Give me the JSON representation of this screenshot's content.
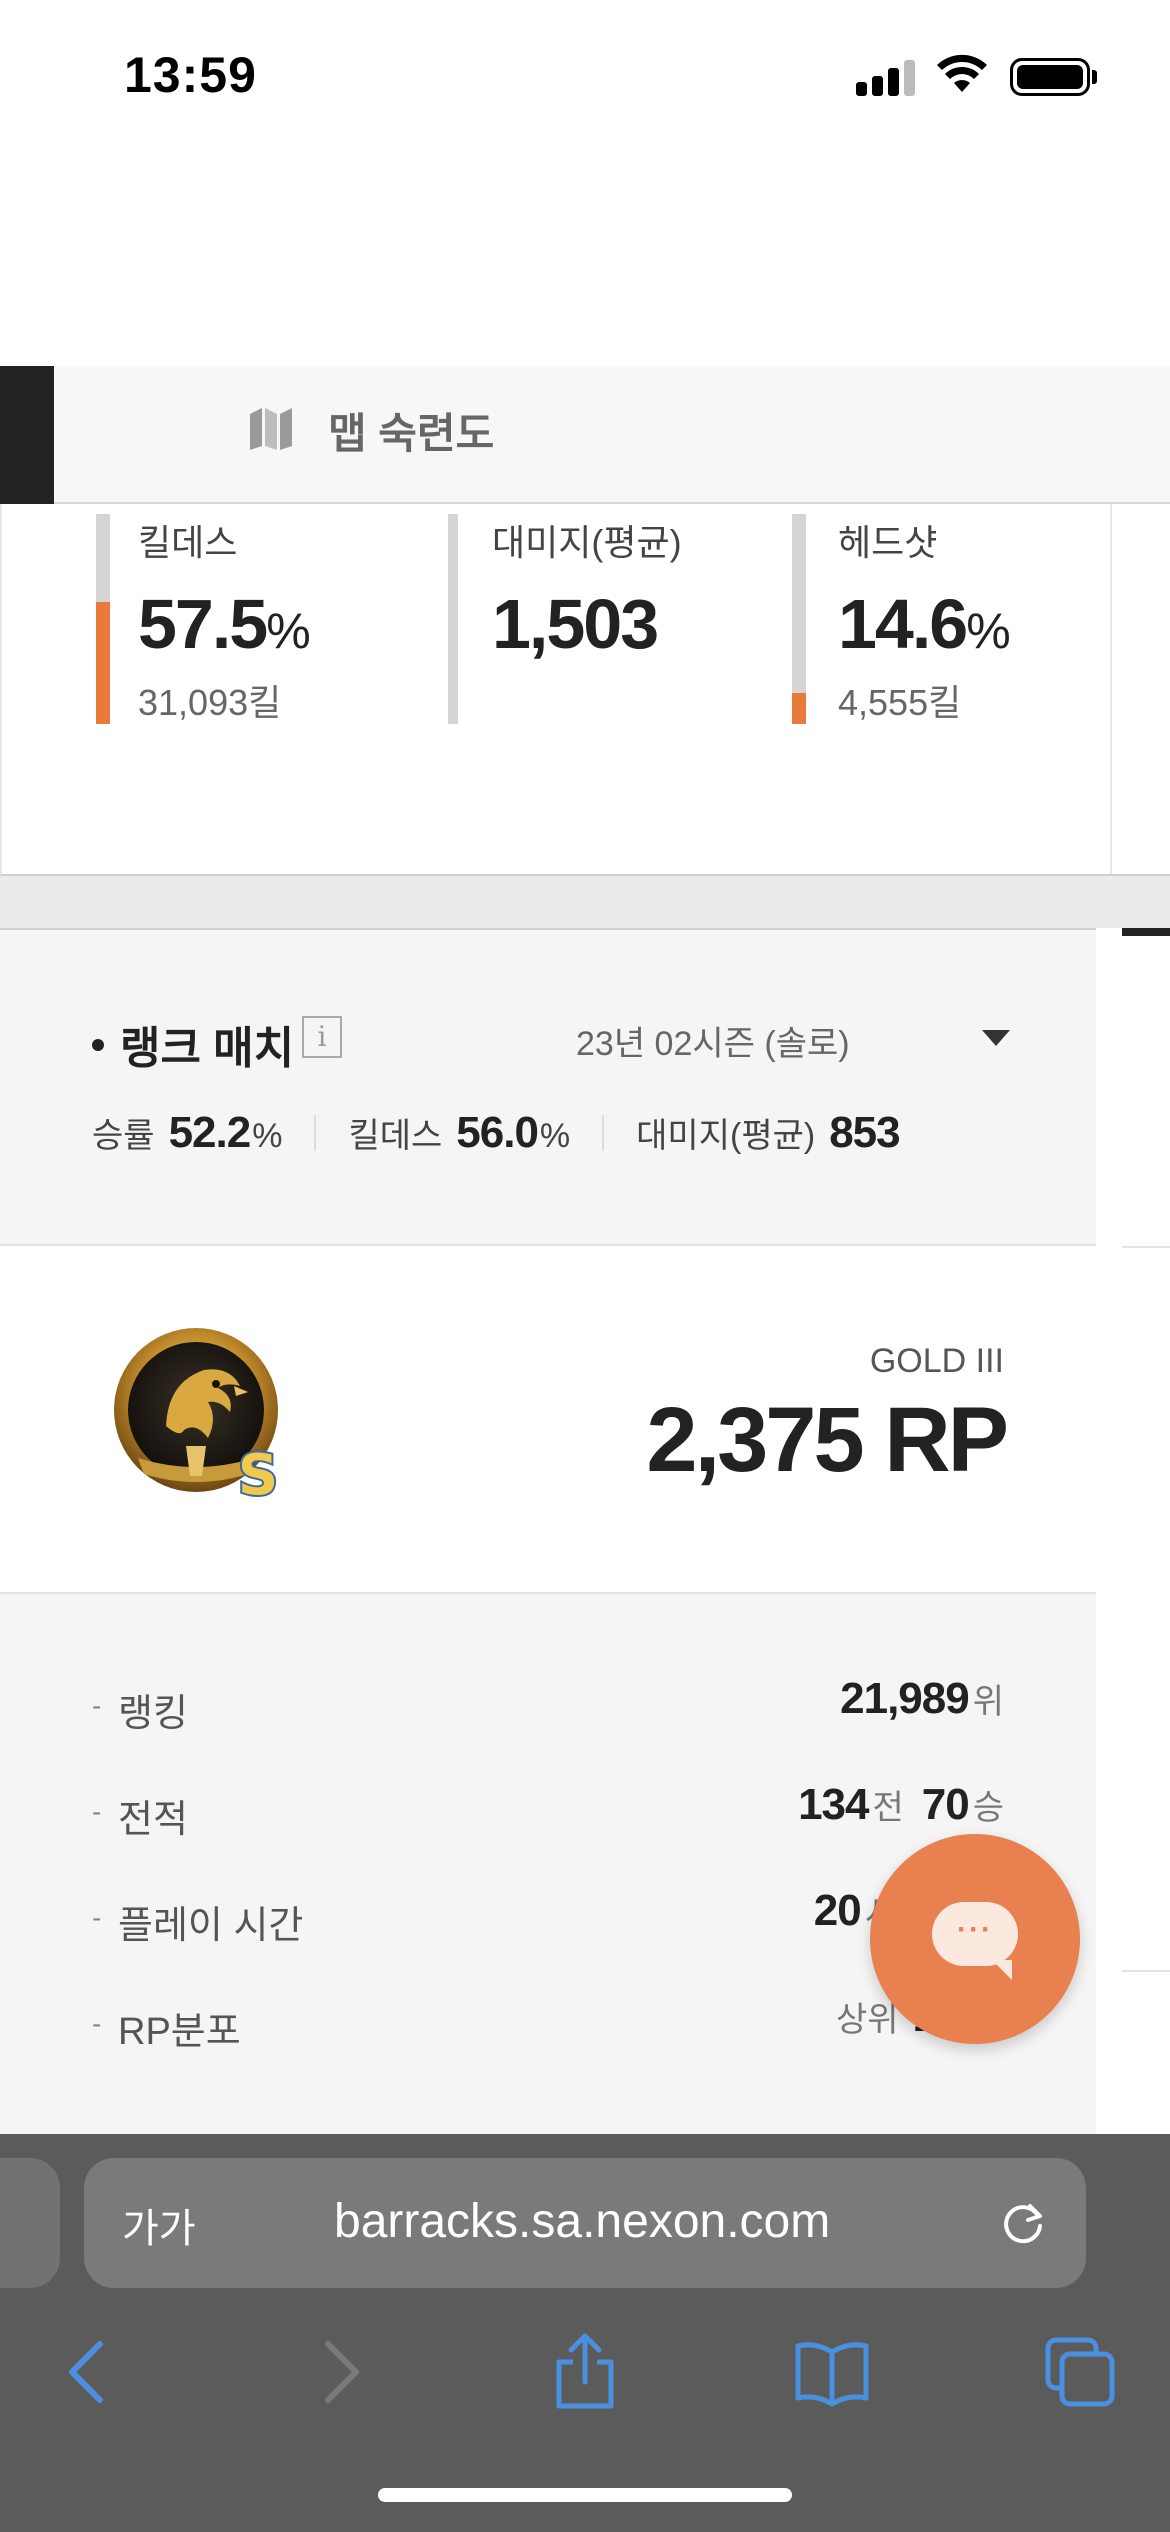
{
  "status_bar": {
    "time": "13:59"
  },
  "map_tab": {
    "label": "맵 숙련도",
    "icon": "map-icon"
  },
  "stats": [
    {
      "label": "킬데스",
      "value": "57.5",
      "unit": "%",
      "sub": "31,093킬",
      "bar_level": 0.575
    },
    {
      "label": "대미지(평균)",
      "value": "1,503",
      "unit": "",
      "sub": "",
      "bar_level": 0
    },
    {
      "label": "헤드샷",
      "value": "14.6",
      "unit": "%",
      "sub": "4,555킬",
      "bar_level": 0.146
    }
  ],
  "rank_match": {
    "title": "랭크 매치",
    "season": "23년 02시즌 (솔로)",
    "summary": {
      "winrate_label": "승률",
      "winrate_value": "52.2",
      "kd_label": "킬데스",
      "kd_value": "56.0",
      "pct": "%",
      "damage_label": "대미지(평균)",
      "damage_value": "853"
    },
    "tier": {
      "name": "GOLD III",
      "rp": "2,375 RP",
      "emblem": "gold-eagle-emblem",
      "emblem_letter": "S"
    },
    "details": {
      "ranking_label": "랭킹",
      "ranking_value": "21,989",
      "ranking_unit": "위",
      "record_label": "전적",
      "record_games": "134",
      "record_games_unit": "전",
      "record_wins": "70",
      "record_wins_unit": "승",
      "playtime_label": "플레이 시간",
      "playtime_value": "20",
      "playtime_unit": "시",
      "rp_dist_label": "RP분포",
      "rp_dist_prefix": "상위",
      "rp_dist_value": "1"
    }
  },
  "chat_button": {
    "icon": "chat-bubble-icon",
    "dots": "···"
  },
  "browser": {
    "aa_label": "가가",
    "url": "barracks.sa.nexon.com"
  },
  "colors": {
    "accent_orange": "#e87a3c",
    "fab_orange": "#e8804f",
    "ios_blue": "#4a90e2",
    "browser_gray": "#5b5b5b"
  }
}
